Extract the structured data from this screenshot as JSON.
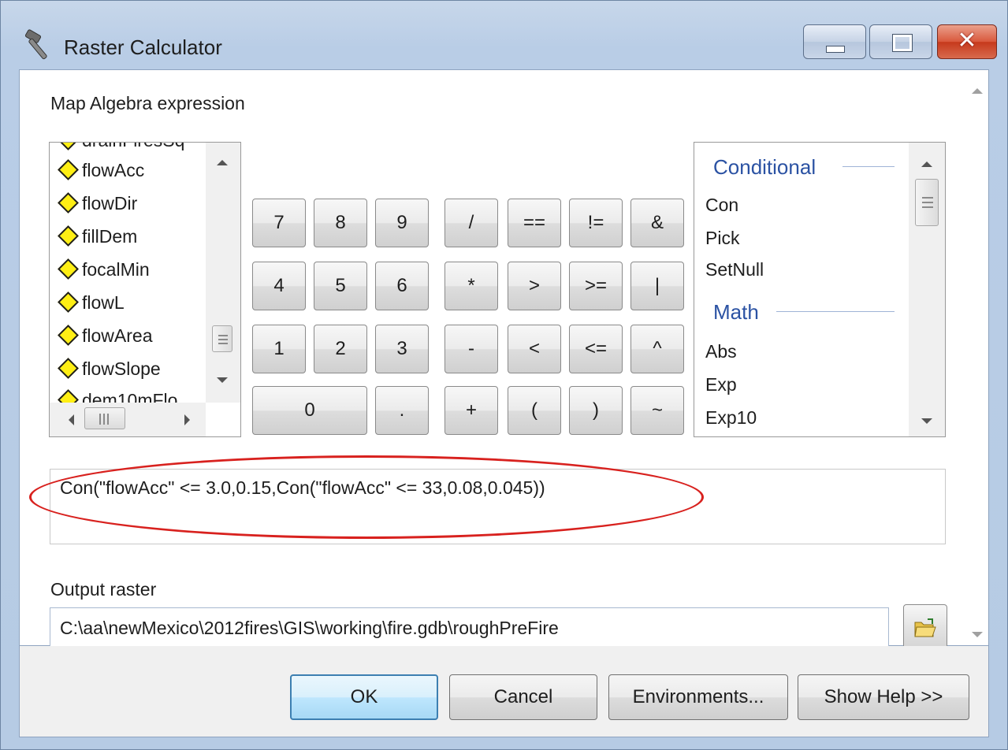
{
  "window": {
    "title": "Raster Calculator",
    "icon": "hammer-icon",
    "controls": {
      "minimize": "minimize-icon",
      "maximize": "maximize-icon",
      "close": "✕"
    }
  },
  "expression_section": {
    "label": "Map Algebra expression"
  },
  "layers": {
    "items": [
      "flowAcc",
      "flowDir",
      "fillDem",
      "focalMin",
      "flowL",
      "flowArea",
      "flowSlope"
    ],
    "partial_top": "drainFiresSq",
    "partial_bottom": "dem10mFlo"
  },
  "calculator": {
    "rows": [
      [
        "7",
        "8",
        "9",
        "/",
        "==",
        "!=",
        "&"
      ],
      [
        "4",
        "5",
        "6",
        "*",
        ">",
        ">=",
        "|"
      ],
      [
        "1",
        "2",
        "3",
        "-",
        "<",
        "<=",
        "^"
      ],
      [
        "0",
        ".",
        "+",
        "(",
        ")",
        "~"
      ]
    ]
  },
  "functions": {
    "groups": [
      {
        "header": "Conditional",
        "items": [
          "Con",
          "Pick",
          "SetNull"
        ]
      },
      {
        "header": "Math",
        "items": [
          "Abs",
          "Exp",
          "Exp10"
        ]
      }
    ]
  },
  "expression": {
    "value": "Con(\"flowAcc\" <= 3.0,0.15,Con(\"flowAcc\" <= 33,0.08,0.045))"
  },
  "output": {
    "label": "Output raster",
    "value": "C:\\aa\\newMexico\\2012fires\\GIS\\working\\fire.gdb\\roughPreFire",
    "browse_icon": "folder-open-icon"
  },
  "buttons": {
    "ok": "OK",
    "cancel": "Cancel",
    "environments": "Environments...",
    "help": "Show Help >>"
  },
  "colors": {
    "highlight_ellipse": "#d8211e",
    "function_header": "#2b52a3",
    "layer_diamond": "#ffef14"
  }
}
